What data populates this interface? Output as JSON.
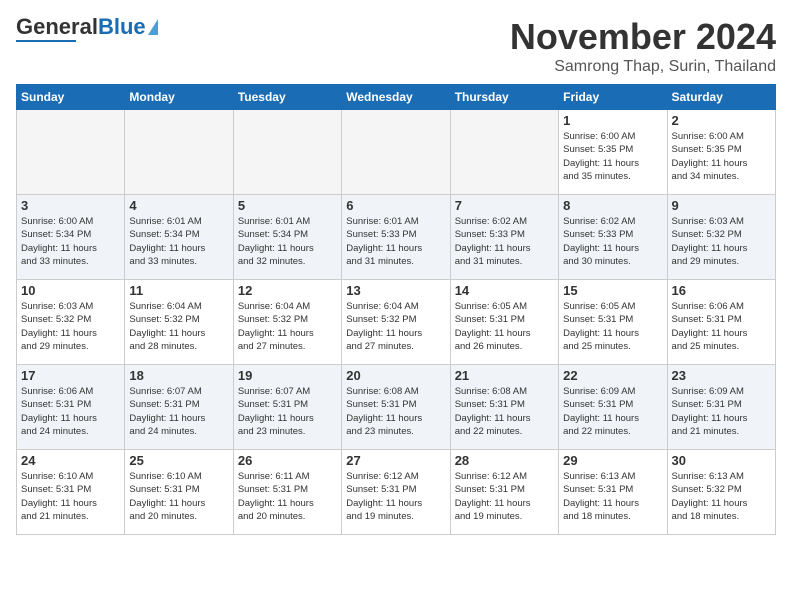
{
  "header": {
    "logo_general": "General",
    "logo_blue": "Blue",
    "month": "November 2024",
    "location": "Samrong Thap, Surin, Thailand"
  },
  "weekdays": [
    "Sunday",
    "Monday",
    "Tuesday",
    "Wednesday",
    "Thursday",
    "Friday",
    "Saturday"
  ],
  "weeks": [
    {
      "alt": false,
      "days": [
        {
          "num": "",
          "info": ""
        },
        {
          "num": "",
          "info": ""
        },
        {
          "num": "",
          "info": ""
        },
        {
          "num": "",
          "info": ""
        },
        {
          "num": "",
          "info": ""
        },
        {
          "num": "1",
          "info": "Sunrise: 6:00 AM\nSunset: 5:35 PM\nDaylight: 11 hours\nand 35 minutes."
        },
        {
          "num": "2",
          "info": "Sunrise: 6:00 AM\nSunset: 5:35 PM\nDaylight: 11 hours\nand 34 minutes."
        }
      ]
    },
    {
      "alt": true,
      "days": [
        {
          "num": "3",
          "info": "Sunrise: 6:00 AM\nSunset: 5:34 PM\nDaylight: 11 hours\nand 33 minutes."
        },
        {
          "num": "4",
          "info": "Sunrise: 6:01 AM\nSunset: 5:34 PM\nDaylight: 11 hours\nand 33 minutes."
        },
        {
          "num": "5",
          "info": "Sunrise: 6:01 AM\nSunset: 5:34 PM\nDaylight: 11 hours\nand 32 minutes."
        },
        {
          "num": "6",
          "info": "Sunrise: 6:01 AM\nSunset: 5:33 PM\nDaylight: 11 hours\nand 31 minutes."
        },
        {
          "num": "7",
          "info": "Sunrise: 6:02 AM\nSunset: 5:33 PM\nDaylight: 11 hours\nand 31 minutes."
        },
        {
          "num": "8",
          "info": "Sunrise: 6:02 AM\nSunset: 5:33 PM\nDaylight: 11 hours\nand 30 minutes."
        },
        {
          "num": "9",
          "info": "Sunrise: 6:03 AM\nSunset: 5:32 PM\nDaylight: 11 hours\nand 29 minutes."
        }
      ]
    },
    {
      "alt": false,
      "days": [
        {
          "num": "10",
          "info": "Sunrise: 6:03 AM\nSunset: 5:32 PM\nDaylight: 11 hours\nand 29 minutes."
        },
        {
          "num": "11",
          "info": "Sunrise: 6:04 AM\nSunset: 5:32 PM\nDaylight: 11 hours\nand 28 minutes."
        },
        {
          "num": "12",
          "info": "Sunrise: 6:04 AM\nSunset: 5:32 PM\nDaylight: 11 hours\nand 27 minutes."
        },
        {
          "num": "13",
          "info": "Sunrise: 6:04 AM\nSunset: 5:32 PM\nDaylight: 11 hours\nand 27 minutes."
        },
        {
          "num": "14",
          "info": "Sunrise: 6:05 AM\nSunset: 5:31 PM\nDaylight: 11 hours\nand 26 minutes."
        },
        {
          "num": "15",
          "info": "Sunrise: 6:05 AM\nSunset: 5:31 PM\nDaylight: 11 hours\nand 25 minutes."
        },
        {
          "num": "16",
          "info": "Sunrise: 6:06 AM\nSunset: 5:31 PM\nDaylight: 11 hours\nand 25 minutes."
        }
      ]
    },
    {
      "alt": true,
      "days": [
        {
          "num": "17",
          "info": "Sunrise: 6:06 AM\nSunset: 5:31 PM\nDaylight: 11 hours\nand 24 minutes."
        },
        {
          "num": "18",
          "info": "Sunrise: 6:07 AM\nSunset: 5:31 PM\nDaylight: 11 hours\nand 24 minutes."
        },
        {
          "num": "19",
          "info": "Sunrise: 6:07 AM\nSunset: 5:31 PM\nDaylight: 11 hours\nand 23 minutes."
        },
        {
          "num": "20",
          "info": "Sunrise: 6:08 AM\nSunset: 5:31 PM\nDaylight: 11 hours\nand 23 minutes."
        },
        {
          "num": "21",
          "info": "Sunrise: 6:08 AM\nSunset: 5:31 PM\nDaylight: 11 hours\nand 22 minutes."
        },
        {
          "num": "22",
          "info": "Sunrise: 6:09 AM\nSunset: 5:31 PM\nDaylight: 11 hours\nand 22 minutes."
        },
        {
          "num": "23",
          "info": "Sunrise: 6:09 AM\nSunset: 5:31 PM\nDaylight: 11 hours\nand 21 minutes."
        }
      ]
    },
    {
      "alt": false,
      "days": [
        {
          "num": "24",
          "info": "Sunrise: 6:10 AM\nSunset: 5:31 PM\nDaylight: 11 hours\nand 21 minutes."
        },
        {
          "num": "25",
          "info": "Sunrise: 6:10 AM\nSunset: 5:31 PM\nDaylight: 11 hours\nand 20 minutes."
        },
        {
          "num": "26",
          "info": "Sunrise: 6:11 AM\nSunset: 5:31 PM\nDaylight: 11 hours\nand 20 minutes."
        },
        {
          "num": "27",
          "info": "Sunrise: 6:12 AM\nSunset: 5:31 PM\nDaylight: 11 hours\nand 19 minutes."
        },
        {
          "num": "28",
          "info": "Sunrise: 6:12 AM\nSunset: 5:31 PM\nDaylight: 11 hours\nand 19 minutes."
        },
        {
          "num": "29",
          "info": "Sunrise: 6:13 AM\nSunset: 5:31 PM\nDaylight: 11 hours\nand 18 minutes."
        },
        {
          "num": "30",
          "info": "Sunrise: 6:13 AM\nSunset: 5:32 PM\nDaylight: 11 hours\nand 18 minutes."
        }
      ]
    }
  ]
}
